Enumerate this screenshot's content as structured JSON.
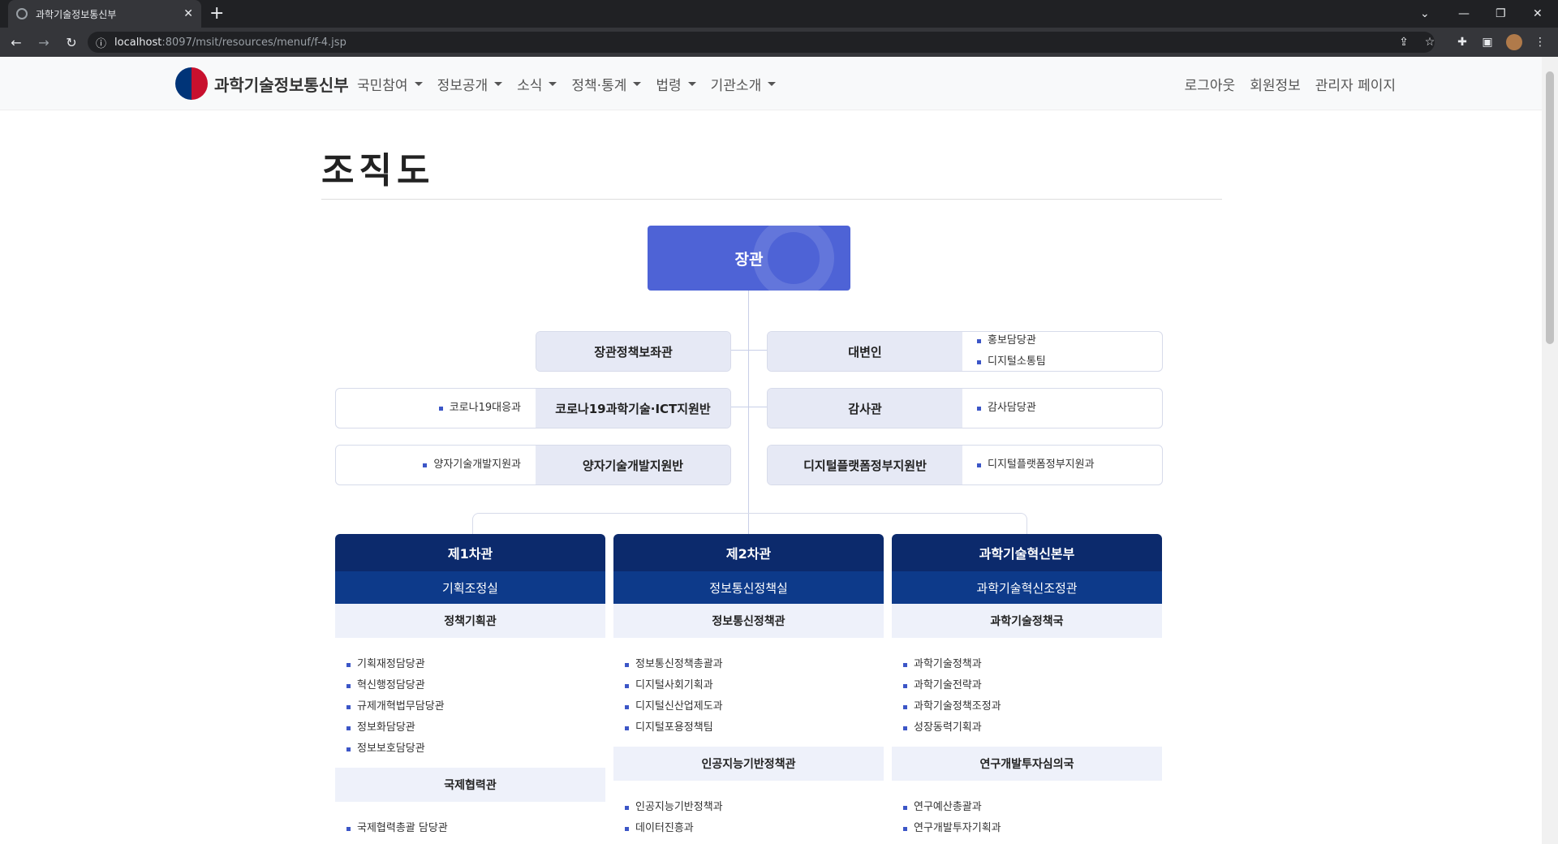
{
  "browser": {
    "tab_title": "과학기술정보통신부",
    "url_host": "localhost",
    "url_path": ":8097/msit/resources/menuf/f-4.jsp"
  },
  "site": {
    "logo_text": "과학기술정보통신부",
    "nav": [
      "국민참여",
      "정보공개",
      "소식",
      "정책·통계",
      "법령",
      "기관소개"
    ],
    "user_links": [
      "로그아웃",
      "회원정보",
      "관리자 페이지"
    ]
  },
  "page": {
    "title": "조직도"
  },
  "org": {
    "minister": "장관",
    "staff_left": [
      {
        "head": "장관정책보좌관",
        "items": []
      },
      {
        "head": "코로나19과학기술·ICT지원반",
        "items": [
          "코로나19대응과"
        ]
      },
      {
        "head": "양자기술개발지원반",
        "items": [
          "양자기술개발지원과"
        ]
      }
    ],
    "staff_right": [
      {
        "head": "대변인",
        "items": [
          "홍보담당관",
          "디지털소통팀"
        ]
      },
      {
        "head": "감사관",
        "items": [
          "감사담당관"
        ]
      },
      {
        "head": "디지털플랫폼정부지원반",
        "items": [
          "디지털플랫폼정부지원과"
        ]
      }
    ],
    "columns": [
      {
        "vice": "제1차관",
        "office": "기획조정실",
        "bureaus": [
          {
            "name": "정책기획관",
            "items": [
              "기획재정담당관",
              "혁신행정담당관",
              "규제개혁법무담당관",
              "정보화담당관",
              "정보보호담당관"
            ]
          },
          {
            "name": "국제협력관",
            "items": [
              "국제협력총괄 담당관"
            ]
          }
        ]
      },
      {
        "vice": "제2차관",
        "office": "정보통신정책실",
        "bureaus": [
          {
            "name": "정보통신정책관",
            "items": [
              "정보통신정책총괄과",
              "디지털사회기획과",
              "디지털신산업제도과",
              "디지털포용정책팀"
            ]
          },
          {
            "name": "인공지능기반정책관",
            "items": [
              "인공지능기반정책과",
              "데이터진흥과"
            ]
          }
        ]
      },
      {
        "vice": "과학기술혁신본부",
        "office": "과학기술혁신조정관",
        "bureaus": [
          {
            "name": "과학기술정책국",
            "items": [
              "과학기술정책과",
              "과학기술전략과",
              "과학기술정책조정과",
              "성장동력기획과"
            ]
          },
          {
            "name": "연구개발투자심의국",
            "items": [
              "연구예산총괄과",
              "연구개발투자기획과"
            ]
          }
        ]
      }
    ]
  }
}
